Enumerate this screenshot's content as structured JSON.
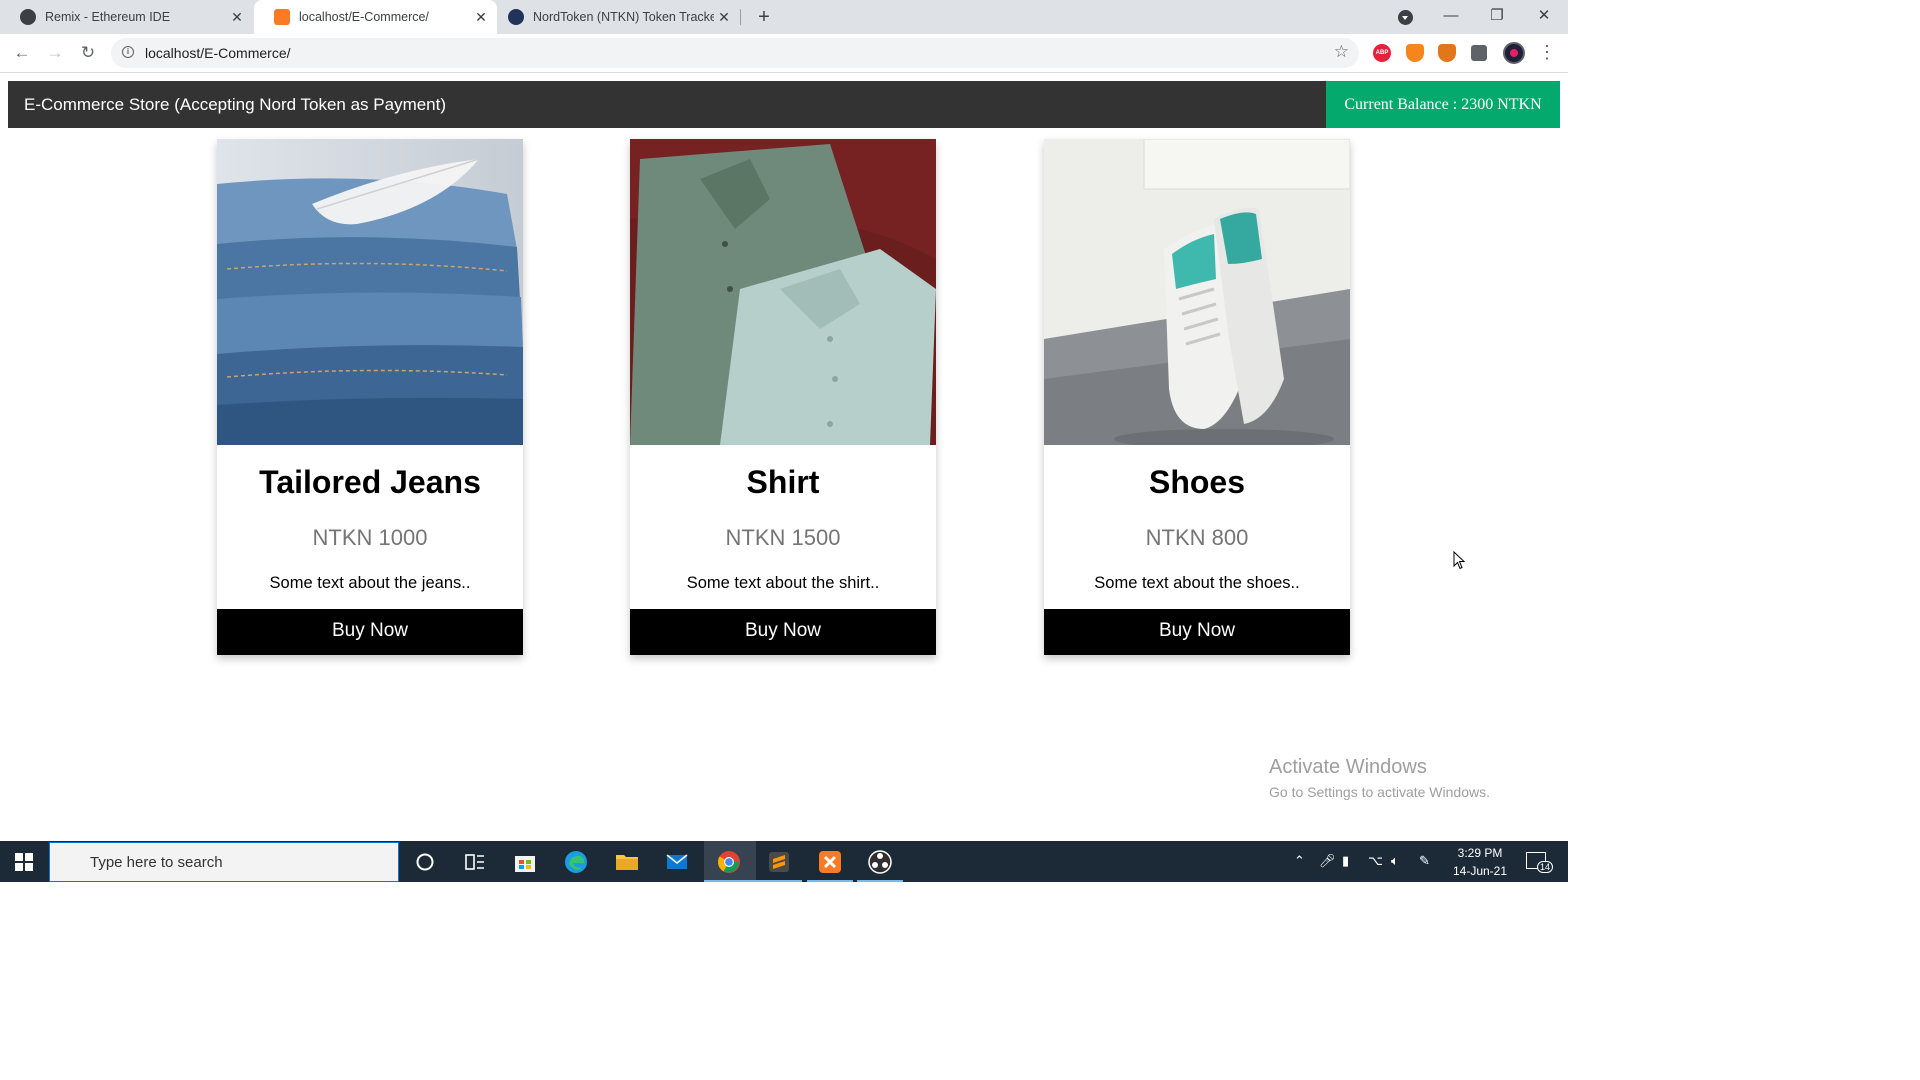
{
  "browser": {
    "tabs": [
      {
        "title": "Remix - Ethereum IDE",
        "active": false
      },
      {
        "title": "localhost/E-Commerce/",
        "active": true
      },
      {
        "title": "NordToken (NTKN) Token Tracker",
        "active": false
      }
    ],
    "url": "localhost/E-Commerce/",
    "extensions": {
      "abp_label": "ABP"
    }
  },
  "page": {
    "header_title": "E-Commerce Store (Accepting Nord Token as Payment)",
    "balance": "Current Balance : 2300 NTKN",
    "products": [
      {
        "name": "Tailored Jeans",
        "price": "NTKN 1000",
        "description": "Some text about the jeans..",
        "button": "Buy Now",
        "image": "folded-denim-jeans-with-feather"
      },
      {
        "name": "Shirt",
        "price": "NTKN 1500",
        "description": "Some text about the shirt..",
        "button": "Buy Now",
        "image": "two-folded-button-down-shirts"
      },
      {
        "name": "Shoes",
        "price": "NTKN 800",
        "description": "Some text about the shoes..",
        "button": "Buy Now",
        "image": "white-sneakers-on-floor"
      }
    ]
  },
  "watermark": {
    "line1": "Activate Windows",
    "line2": "Go to Settings to activate Windows."
  },
  "taskbar": {
    "search_placeholder": "Type here to search",
    "time": "3:29 PM",
    "date": "14-Jun-21",
    "notification_count": "14"
  }
}
